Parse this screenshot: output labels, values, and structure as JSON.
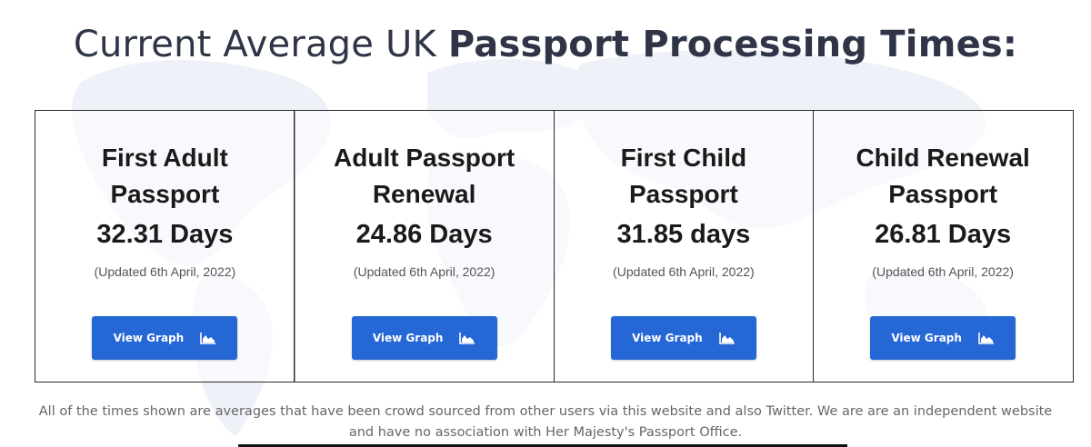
{
  "header": {
    "title_regular": "Current Average UK ",
    "title_bold": "Passport Processing Times:"
  },
  "cards": [
    {
      "title": "First Adult Passport",
      "days": "32.31 Days",
      "updated": "(Updated 6th April, 2022)",
      "button_label": "View Graph"
    },
    {
      "title": "Adult Passport Renewal",
      "days": "24.86 Days",
      "updated": "(Updated 6th April, 2022)",
      "button_label": "View Graph"
    },
    {
      "title": "First Child Passport",
      "days": "31.85 days",
      "updated": "(Updated 6th April, 2022)",
      "button_label": "View Graph"
    },
    {
      "title": "Child Renewal Passport",
      "days": "26.81 Days",
      "updated": "(Updated 6th April, 2022)",
      "button_label": "View Graph"
    }
  ],
  "footnote": {
    "text": "All of the times shown are averages that have been crowd sourced from other users via this website and also Twitter. We are are an independent website and have no association with Her Majesty's Passport Office."
  },
  "icons": {
    "button_icon": "area-chart-icon",
    "background": "world-map-icon"
  },
  "colors": {
    "button": "#2667d6",
    "title": "#2f3547",
    "border": "#2a2a2a"
  }
}
